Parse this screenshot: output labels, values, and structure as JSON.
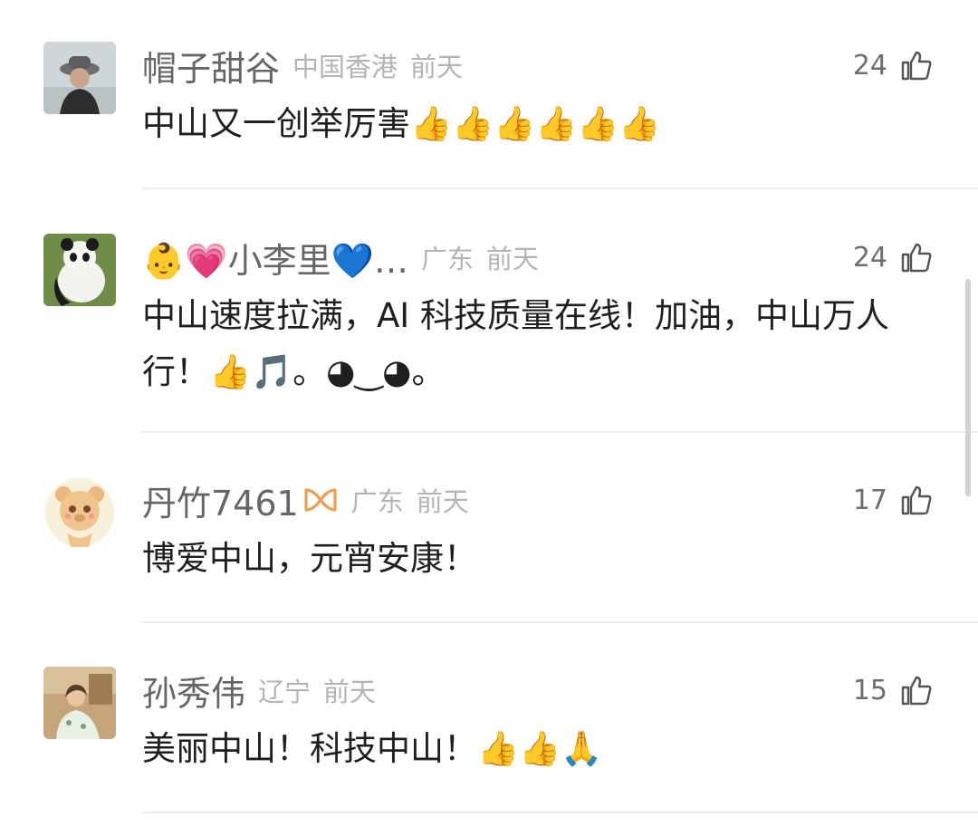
{
  "comments": [
    {
      "name": "帽子甜谷",
      "location": "中国香港",
      "time": "前天",
      "likes": "24",
      "text": "中山又一创举厉害👍👍👍👍👍👍",
      "avatar_icon": "person-hat-avatar"
    },
    {
      "name": "👶💗小李里💙…",
      "location": "广东",
      "time": "前天",
      "likes": "24",
      "text": "中山速度拉满，AI 科技质量在线！加油，中山万人行！👍🎵。◕‿◕。",
      "avatar_icon": "panda-avatar"
    },
    {
      "name": "丹竹7461",
      "badge_icon": "orange-infinity-badge-icon",
      "location": "广东",
      "time": "前天",
      "likes": "17",
      "text": "博爱中山，元宵安康！",
      "avatar_icon": "cartoon-bear-avatar"
    },
    {
      "name": "孙秀伟",
      "location": "辽宁",
      "time": "前天",
      "likes": "15",
      "text": "美丽中山！科技中山！👍👍🙏",
      "avatar_icon": "woman-photo-avatar"
    }
  ],
  "colors": {
    "name": "#666666",
    "meta": "#b4b4b4",
    "text": "#1f1f1f",
    "divider": "#eeeeee",
    "accent_badge": "#f0a04a"
  }
}
